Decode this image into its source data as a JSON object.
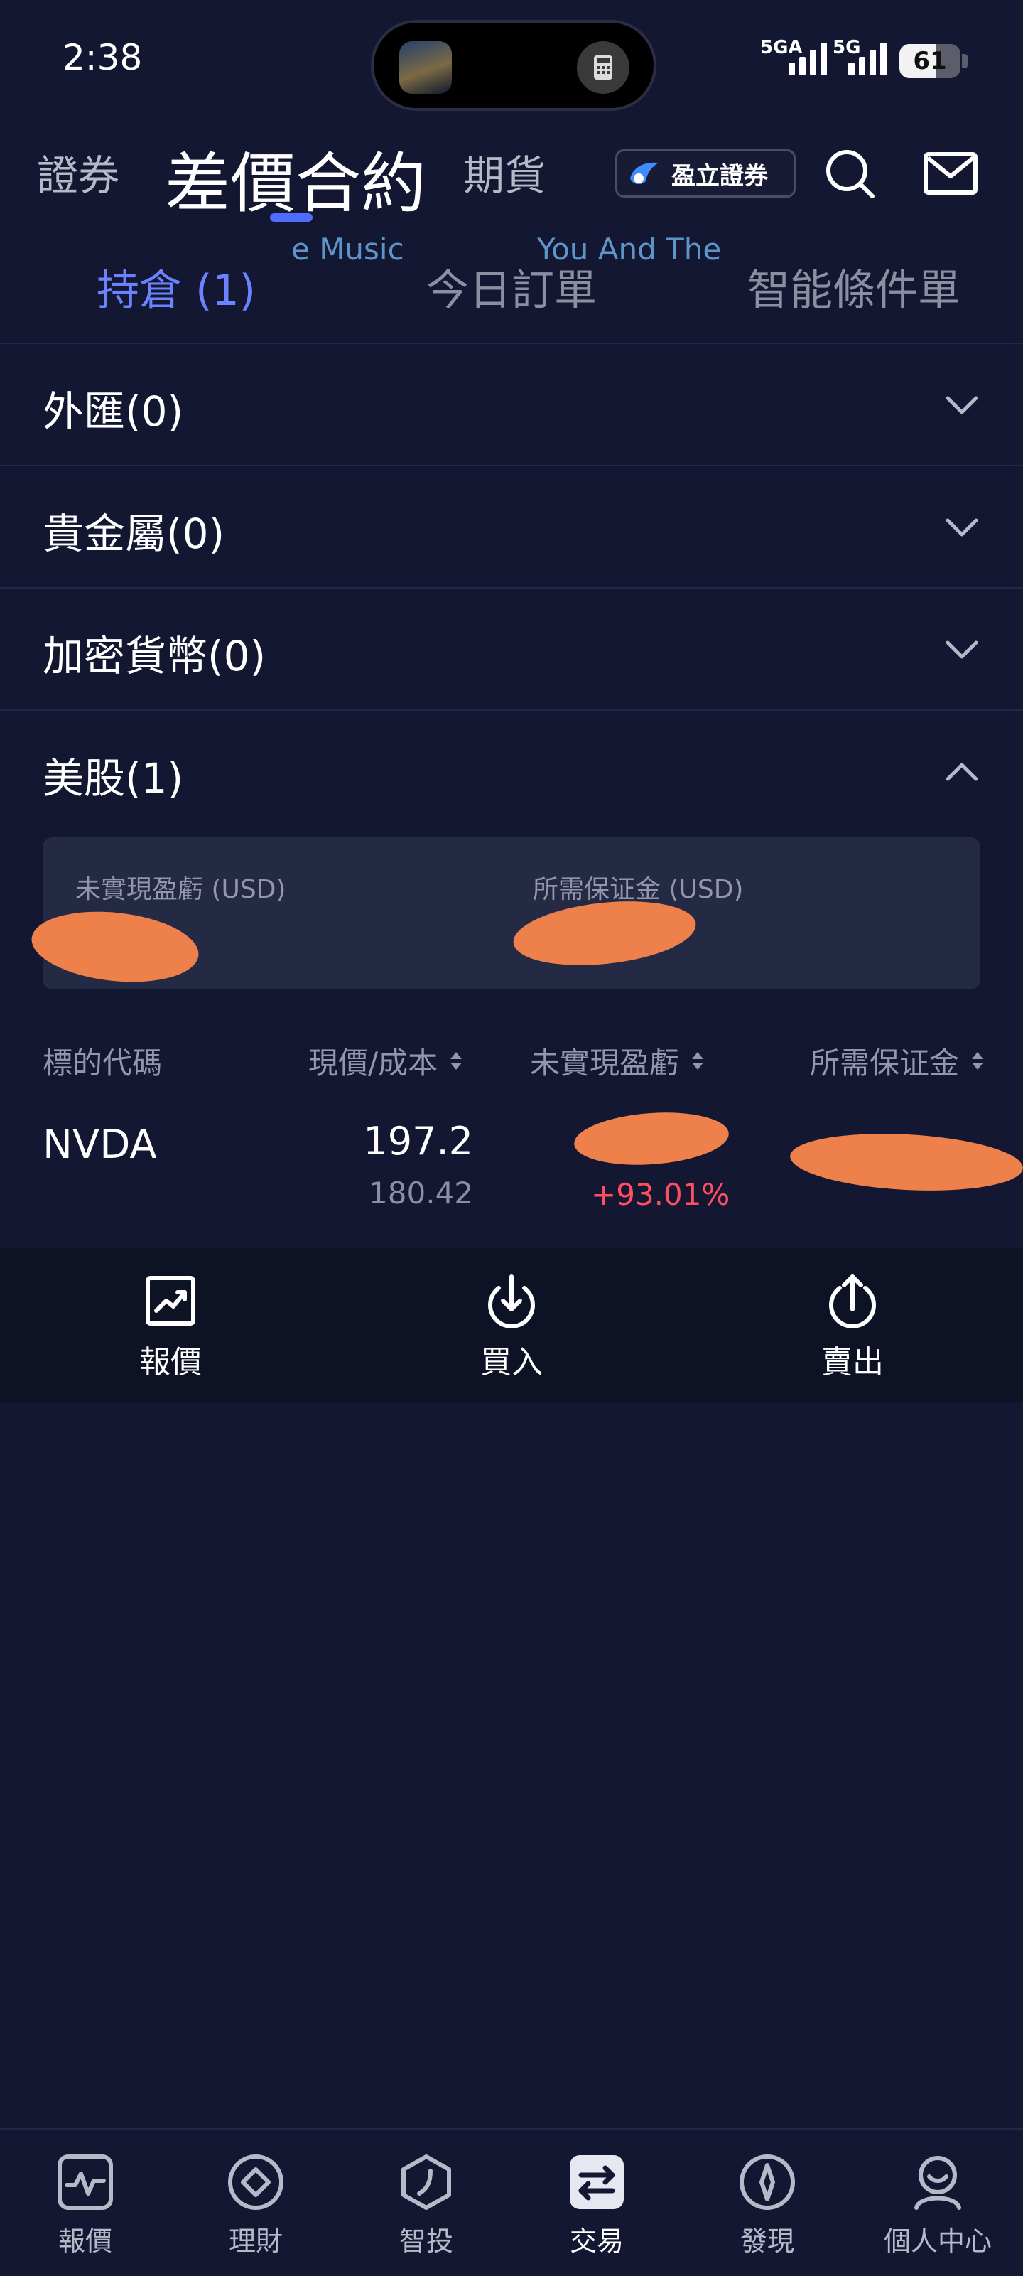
{
  "status_bar": {
    "time": "2:38",
    "sim1_label": "5GA",
    "sim2_label": "5G",
    "battery": "61",
    "battery_level": 0.61
  },
  "top_nav": {
    "tabs": [
      {
        "label": "證券"
      },
      {
        "label": "差價合約"
      },
      {
        "label": "期貨"
      }
    ],
    "active_tab": "差價合約",
    "broker_button": "盈立證券"
  },
  "now_playing": {
    "left": "e Music",
    "right": "You And The"
  },
  "sub_tabs": [
    {
      "label": "持倉 (1)"
    },
    {
      "label": "今日訂單"
    },
    {
      "label": "智能條件單"
    }
  ],
  "sections": [
    {
      "label": "外匯(0)"
    },
    {
      "label": "貴金屬(0)"
    },
    {
      "label": "加密貨幣(0)"
    },
    {
      "label": "美股(1)"
    }
  ],
  "summary": {
    "unrealized_label": "未實現盈虧 (USD)",
    "margin_label": "所需保证金 (USD)"
  },
  "table": {
    "columns": [
      "標的代碼",
      "現價/成本",
      "未實現盈虧",
      "所需保证金"
    ],
    "rows": [
      {
        "symbol": "NVDA",
        "price": "197.2",
        "cost": "180.42",
        "pnl_pct": "+93.01%"
      }
    ]
  },
  "actions": [
    {
      "label": "報價",
      "icon": "chart-icon"
    },
    {
      "label": "買入",
      "icon": "download-arrow-icon"
    },
    {
      "label": "賣出",
      "icon": "upload-arrow-icon"
    }
  ],
  "bottom_tabs": [
    {
      "label": "報價",
      "icon": "pulse-icon"
    },
    {
      "label": "理財",
      "icon": "diamond-icon"
    },
    {
      "label": "智投",
      "icon": "hexagon-icon"
    },
    {
      "label": "交易",
      "icon": "swap-icon"
    },
    {
      "label": "發現",
      "icon": "compass-icon"
    },
    {
      "label": "個人中心",
      "icon": "person-icon"
    }
  ],
  "active_bottom_tab": "交易",
  "colors": {
    "background": "#141732",
    "accent": "#4e6dff",
    "active_subtab": "#6b83ff",
    "gain": "#ff4d62",
    "redaction": "#ee804c"
  }
}
